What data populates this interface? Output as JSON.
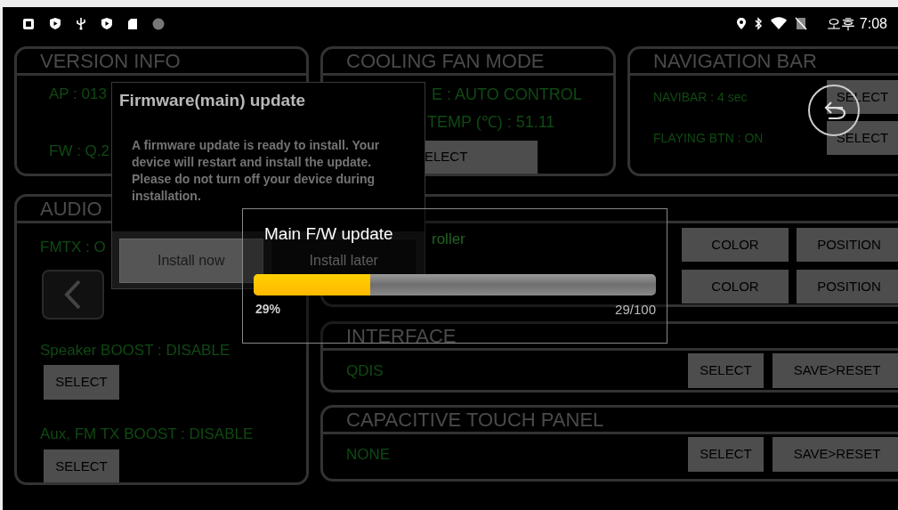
{
  "status_bar": {
    "time": "오후 7:08"
  },
  "panels": {
    "version_info": {
      "title": "VERSION INFO",
      "lines": [
        "AP : 013",
        "FW : Q.2"
      ]
    },
    "cooling_fan_mode": {
      "title": "COOLING FAN MODE",
      "mode": "E : AUTO CONTROL",
      "temp": "TEMP (℃) : 51.11",
      "button": "ELECT"
    },
    "navigation_bar": {
      "title": "NAVIGATION BAR",
      "rows": [
        {
          "label": "NAVIBAR : 4 sec",
          "button": "SELECT"
        },
        {
          "label": "FLAYING BTN : ON",
          "button": "SELECT"
        }
      ]
    },
    "audio": {
      "title": "AUDIO",
      "fmtx": "FMTX : O",
      "boosts": [
        {
          "label": "Speaker BOOST : DISABLE",
          "button": "SELECT"
        },
        {
          "label": "Aux, FM TX BOOST : DISABLE",
          "button": "SELECT"
        }
      ]
    },
    "display": {
      "label": "roller",
      "rows": [
        {
          "buttons": [
            "COLOR",
            "POSITION"
          ]
        },
        {
          "buttons": [
            "COLOR",
            "POSITION"
          ]
        }
      ]
    },
    "interface": {
      "title": "INTERFACE",
      "value": "QDIS",
      "buttons": [
        "SELECT",
        "SAVE>RESET"
      ]
    },
    "touch_panel": {
      "title": "CAPACITIVE TOUCH PANEL",
      "value": "NONE",
      "buttons": [
        "SELECT",
        "SAVE>RESET"
      ]
    }
  },
  "firmware_dialog": {
    "title": "Firmware(main) update",
    "message": "A firmware update is ready to install. Your device will restart and install the update. Please do not turn off your device during installation.",
    "buttons": [
      "Install now",
      "Install later"
    ]
  },
  "progress_dialog": {
    "title": "Main F/W update",
    "level": 0.29,
    "percent": "29%",
    "count": "29/100"
  }
}
